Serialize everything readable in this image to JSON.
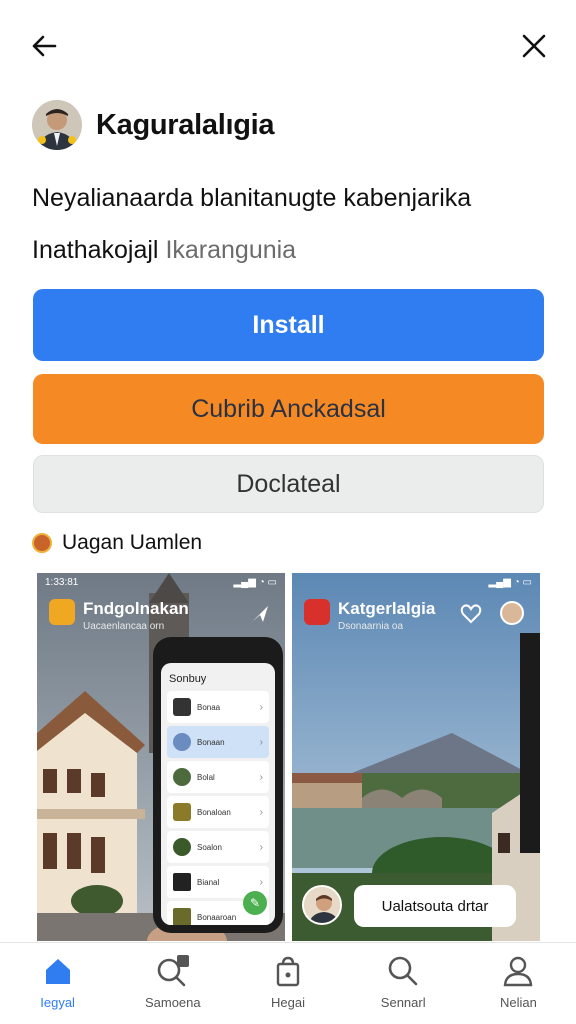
{
  "header": {
    "profile_name": "Kaguralalıgia"
  },
  "description": {
    "line1": "Neyalianaarda blanitanugte kabenjarika",
    "line2_main": "Inathakojajl",
    "line2_muted": "Ikarangunia"
  },
  "buttons": {
    "install": "Install",
    "secondary": "Cubrib Anckadsal",
    "tertiary": "Doclateal"
  },
  "section": {
    "label": "Uagan Uamlen"
  },
  "screenshots": [
    {
      "status_time": "1:33:81",
      "title": "Fndgolnakan",
      "subtitle": "Uacaenlancaa orn",
      "phone_title": "Sonbuy",
      "items": [
        "Bonaa",
        "Bonaan",
        "Bolal",
        "Bonaloan",
        "Soalon",
        "Bianal",
        "Bonaaroan"
      ]
    },
    {
      "title": "Katgerlalgia",
      "subtitle": "Dsonaarnia oa",
      "chat_text": "Ualatsouta drtar"
    }
  ],
  "tabbar": {
    "tabs": [
      {
        "label": "Iegyal",
        "icon": "home-icon"
      },
      {
        "label": "Samoena",
        "icon": "search-edit-icon"
      },
      {
        "label": "Hegai",
        "icon": "bag-icon"
      },
      {
        "label": "Sennarl",
        "icon": "search-icon"
      },
      {
        "label": "Nelian",
        "icon": "profile-icon"
      }
    ]
  },
  "colors": {
    "primary": "#2f7df0",
    "secondary": "#f58a25",
    "tertiary": "#ebecec"
  }
}
